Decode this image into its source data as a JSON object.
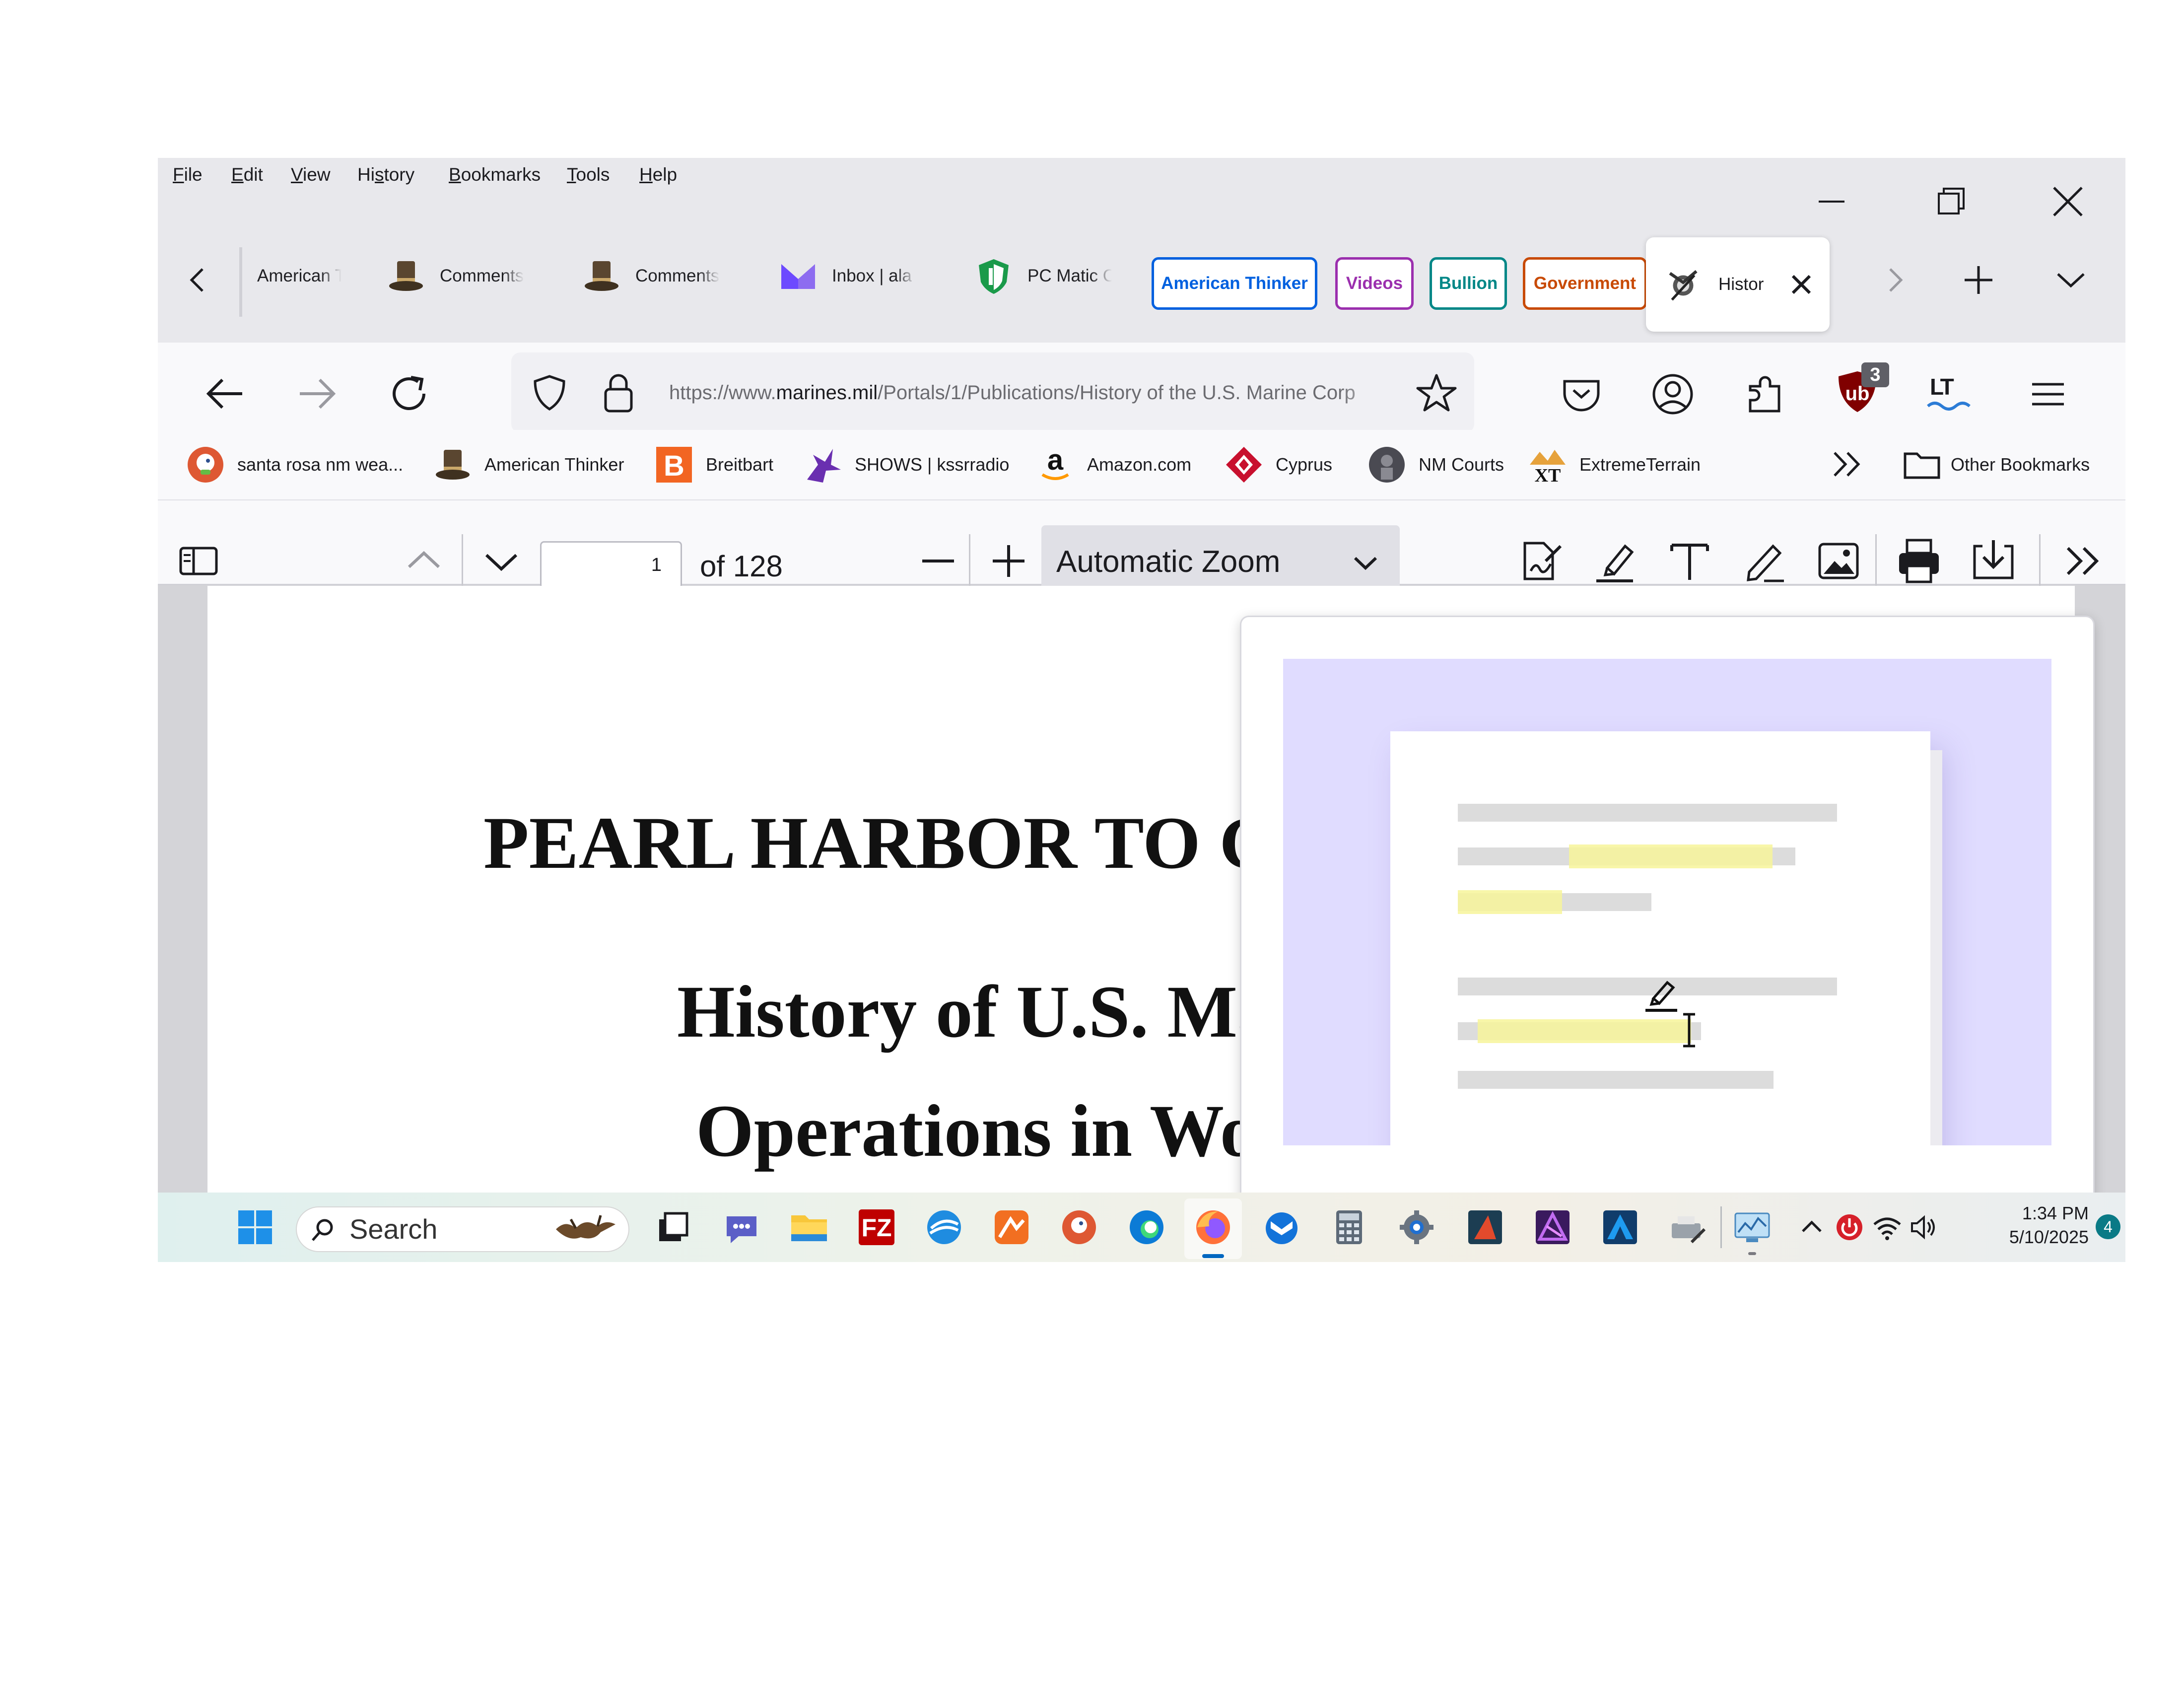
{
  "menu": [
    "File",
    "Edit",
    "View",
    "History",
    "Bookmarks",
    "Tools",
    "Help"
  ],
  "menu_underline": [
    "F",
    "E",
    "V",
    "s",
    "B",
    "T",
    "H"
  ],
  "tabs": [
    {
      "label": "American T",
      "icon": "american-thinker-favicon"
    },
    {
      "label": "Comments",
      "icon": "top-hat-favicon"
    },
    {
      "label": "Comments",
      "icon": "top-hat-favicon"
    },
    {
      "label": "Inbox | ala",
      "icon": "proton-mail-favicon"
    },
    {
      "label": "PC Matic C",
      "icon": "pc-matic-shield-favicon"
    }
  ],
  "tab_groups": [
    {
      "label": "American Thinker",
      "color": "#0060df"
    },
    {
      "label": "Videos",
      "color": "#9b2fae"
    },
    {
      "label": "Bullion",
      "color": "#008787"
    },
    {
      "label": "Government",
      "color": "#c84a05"
    }
  ],
  "active_tab": {
    "label": "Histor",
    "icon": "usmc-emblem-favicon"
  },
  "url": {
    "prefix": "https://www.",
    "domain": "marines.mil",
    "path": "/Portals/1/Publications/History of the U.S. Marine Corp"
  },
  "ublock_badge": "3",
  "lt_label": "LT",
  "bookmarks": [
    {
      "label": "santa rosa nm wea...",
      "icon": "duckduckgo-icon"
    },
    {
      "label": "American Thinker",
      "icon": "top-hat-icon"
    },
    {
      "label": "Breitbart",
      "icon": "breitbart-icon"
    },
    {
      "label": "SHOWS | kssrradio",
      "icon": "kssr-icon"
    },
    {
      "label": "Amazon.com",
      "icon": "amazon-icon"
    },
    {
      "label": "Cyprus",
      "icon": "cyprus-icon"
    },
    {
      "label": "NM Courts",
      "icon": "nm-courts-icon"
    },
    {
      "label": "ExtremeTerrain",
      "icon": "xt-icon"
    }
  ],
  "other_bookmarks": "Other Bookmarks",
  "pdf_toolbar": {
    "page_number": "1",
    "page_count": "of 128",
    "zoom": "Automatic Zoom"
  },
  "pdf_text": {
    "line1": "PEARL HARBOR TO G",
    "line2": "History of U.S. Ma",
    "line3": "Operations in Wo"
  },
  "taskbar": {
    "search_placeholder": "Search",
    "time": "1:34 PM",
    "date": "5/10/2025",
    "notification_count": "4"
  },
  "colors": {
    "highlight_yellow": "#f7f59a",
    "illustration_bg": "#e0dcff"
  }
}
